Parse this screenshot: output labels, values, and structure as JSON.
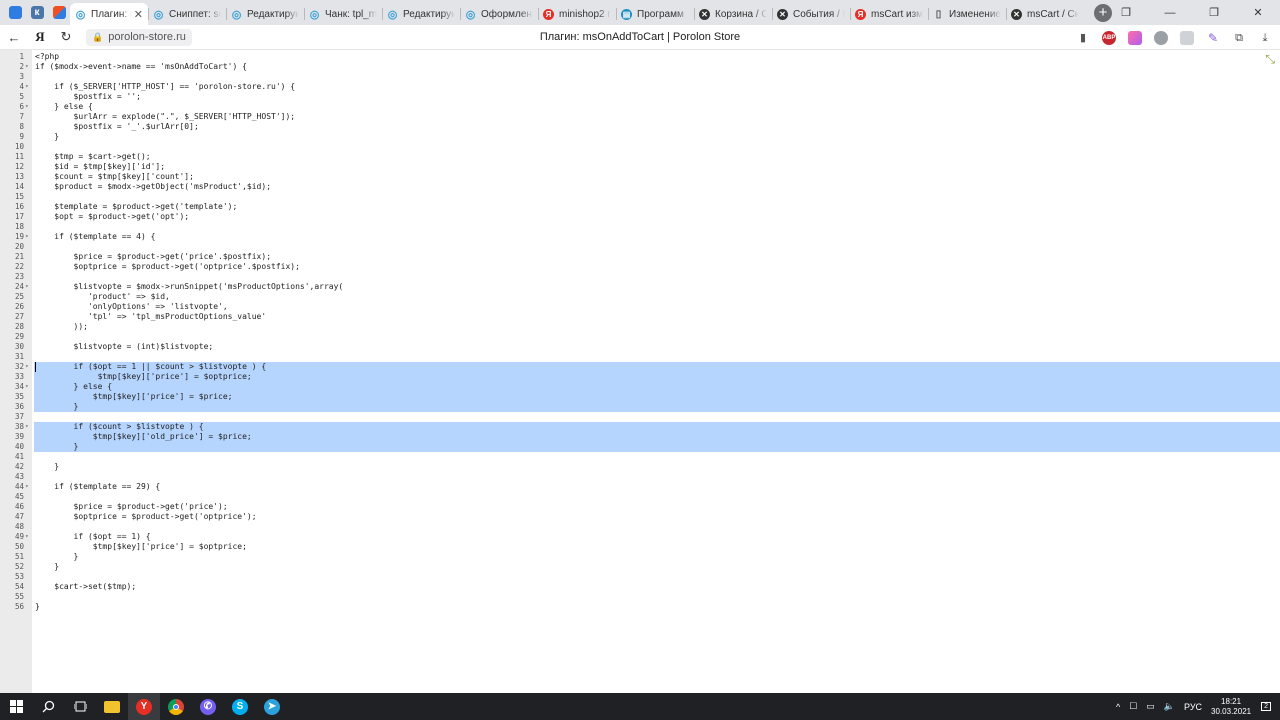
{
  "browser": {
    "tabs": [
      {
        "label": "Плагин: msOnAddToCart | Porolon Store",
        "active": true,
        "icon": "modx-icon"
      },
      {
        "label": "Сниппет: se",
        "icon": "modx-icon"
      },
      {
        "label": "Редактирую",
        "icon": "modx-icon"
      },
      {
        "label": "Чанк: tpl_ms",
        "icon": "modx-icon"
      },
      {
        "label": "Редактирую",
        "icon": "modx-icon"
      },
      {
        "label": "Оформлени",
        "icon": "modx-icon"
      },
      {
        "label": "minishop2 п",
        "icon": "yandex-icon"
      },
      {
        "label": "Программ",
        "icon": "generic-icon"
      },
      {
        "label": "Корзина / С",
        "icon": "x-icon"
      },
      {
        "label": "События / F",
        "icon": "x-icon"
      },
      {
        "label": "msCart изм",
        "icon": "yandex-icon"
      },
      {
        "label": "Изменение",
        "icon": "doc-icon"
      },
      {
        "label": "msCart / Сн",
        "icon": "x-icon"
      }
    ],
    "new_tab": "+",
    "url": "porolon-store.ru",
    "page_title": "Плагин: msOnAddToCart | Porolon Store",
    "yandex_button": "Я",
    "abp_label": "ABP"
  },
  "editor": {
    "selected_from": 32,
    "selected_to": 40,
    "folds": [
      2,
      4,
      6,
      19,
      24,
      32,
      34,
      38,
      44,
      49
    ],
    "lines": [
      "<?php",
      "if ($modx->event->name == 'msOnAddToCart') {",
      "",
      "    if ($_SERVER['HTTP_HOST'] == 'porolon-store.ru') {",
      "        $postfix = '';",
      "    } else {",
      "        $urlArr = explode(\".\", $_SERVER['HTTP_HOST']);",
      "        $postfix = '_'.$urlArr[0];",
      "    }",
      "",
      "    $tmp = $cart->get();",
      "    $id = $tmp[$key]['id'];",
      "    $count = $tmp[$key]['count'];",
      "    $product = $modx->getObject('msProduct',$id);",
      "",
      "    $template = $product->get('template');",
      "    $opt = $product->get('opt');",
      "",
      "    if ($template == 4) {",
      "",
      "        $price = $product->get('price'.$postfix);",
      "        $optprice = $product->get('optprice'.$postfix);",
      "",
      "        $listvopte = $modx->runSnippet('msProductOptions',array(",
      "           'product' => $id,",
      "           'onlyOptions' => 'listvopte',",
      "           'tpl' => 'tpl_msProductOptions_value'",
      "        ));",
      "",
      "        $listvopte = (int)$listvopte;",
      "",
      "        if ($opt == 1 || $count > $listvopte ) {",
      "             $tmp[$key]['price'] = $optprice;",
      "        } else {",
      "            $tmp[$key]['price'] = $price;",
      "        }",
      "",
      "        if ($count > $listvopte ) {",
      "            $tmp[$key]['old_price'] = $price;",
      "        }",
      "",
      "    }",
      "",
      "    if ($template == 29) {",
      "",
      "        $price = $product->get('price');",
      "        $optprice = $product->get('optprice');",
      "",
      "        if ($opt == 1) {",
      "            $tmp[$key]['price'] = $optprice;",
      "        }",
      "    }",
      "",
      "    $cart->set($tmp);",
      "",
      "}"
    ]
  },
  "taskbar": {
    "apps": [
      "start-icon",
      "search-icon",
      "task-view-icon",
      "file-explorer-icon",
      "yandex-browser-icon",
      "chrome-icon",
      "viber-icon",
      "skype-icon",
      "telegram-icon"
    ],
    "lang": "РУС",
    "time": "18:21",
    "date": "30.03.2021",
    "notifications": "2"
  },
  "colors": {
    "tabbar_bg": "#e3e4e8",
    "selection": "#b5d5ff",
    "gutter_bg": "#ebebeb",
    "taskbar_bg": "#202124",
    "modx_blue": "#3aa0d8",
    "yandex_red": "#e62e24"
  }
}
